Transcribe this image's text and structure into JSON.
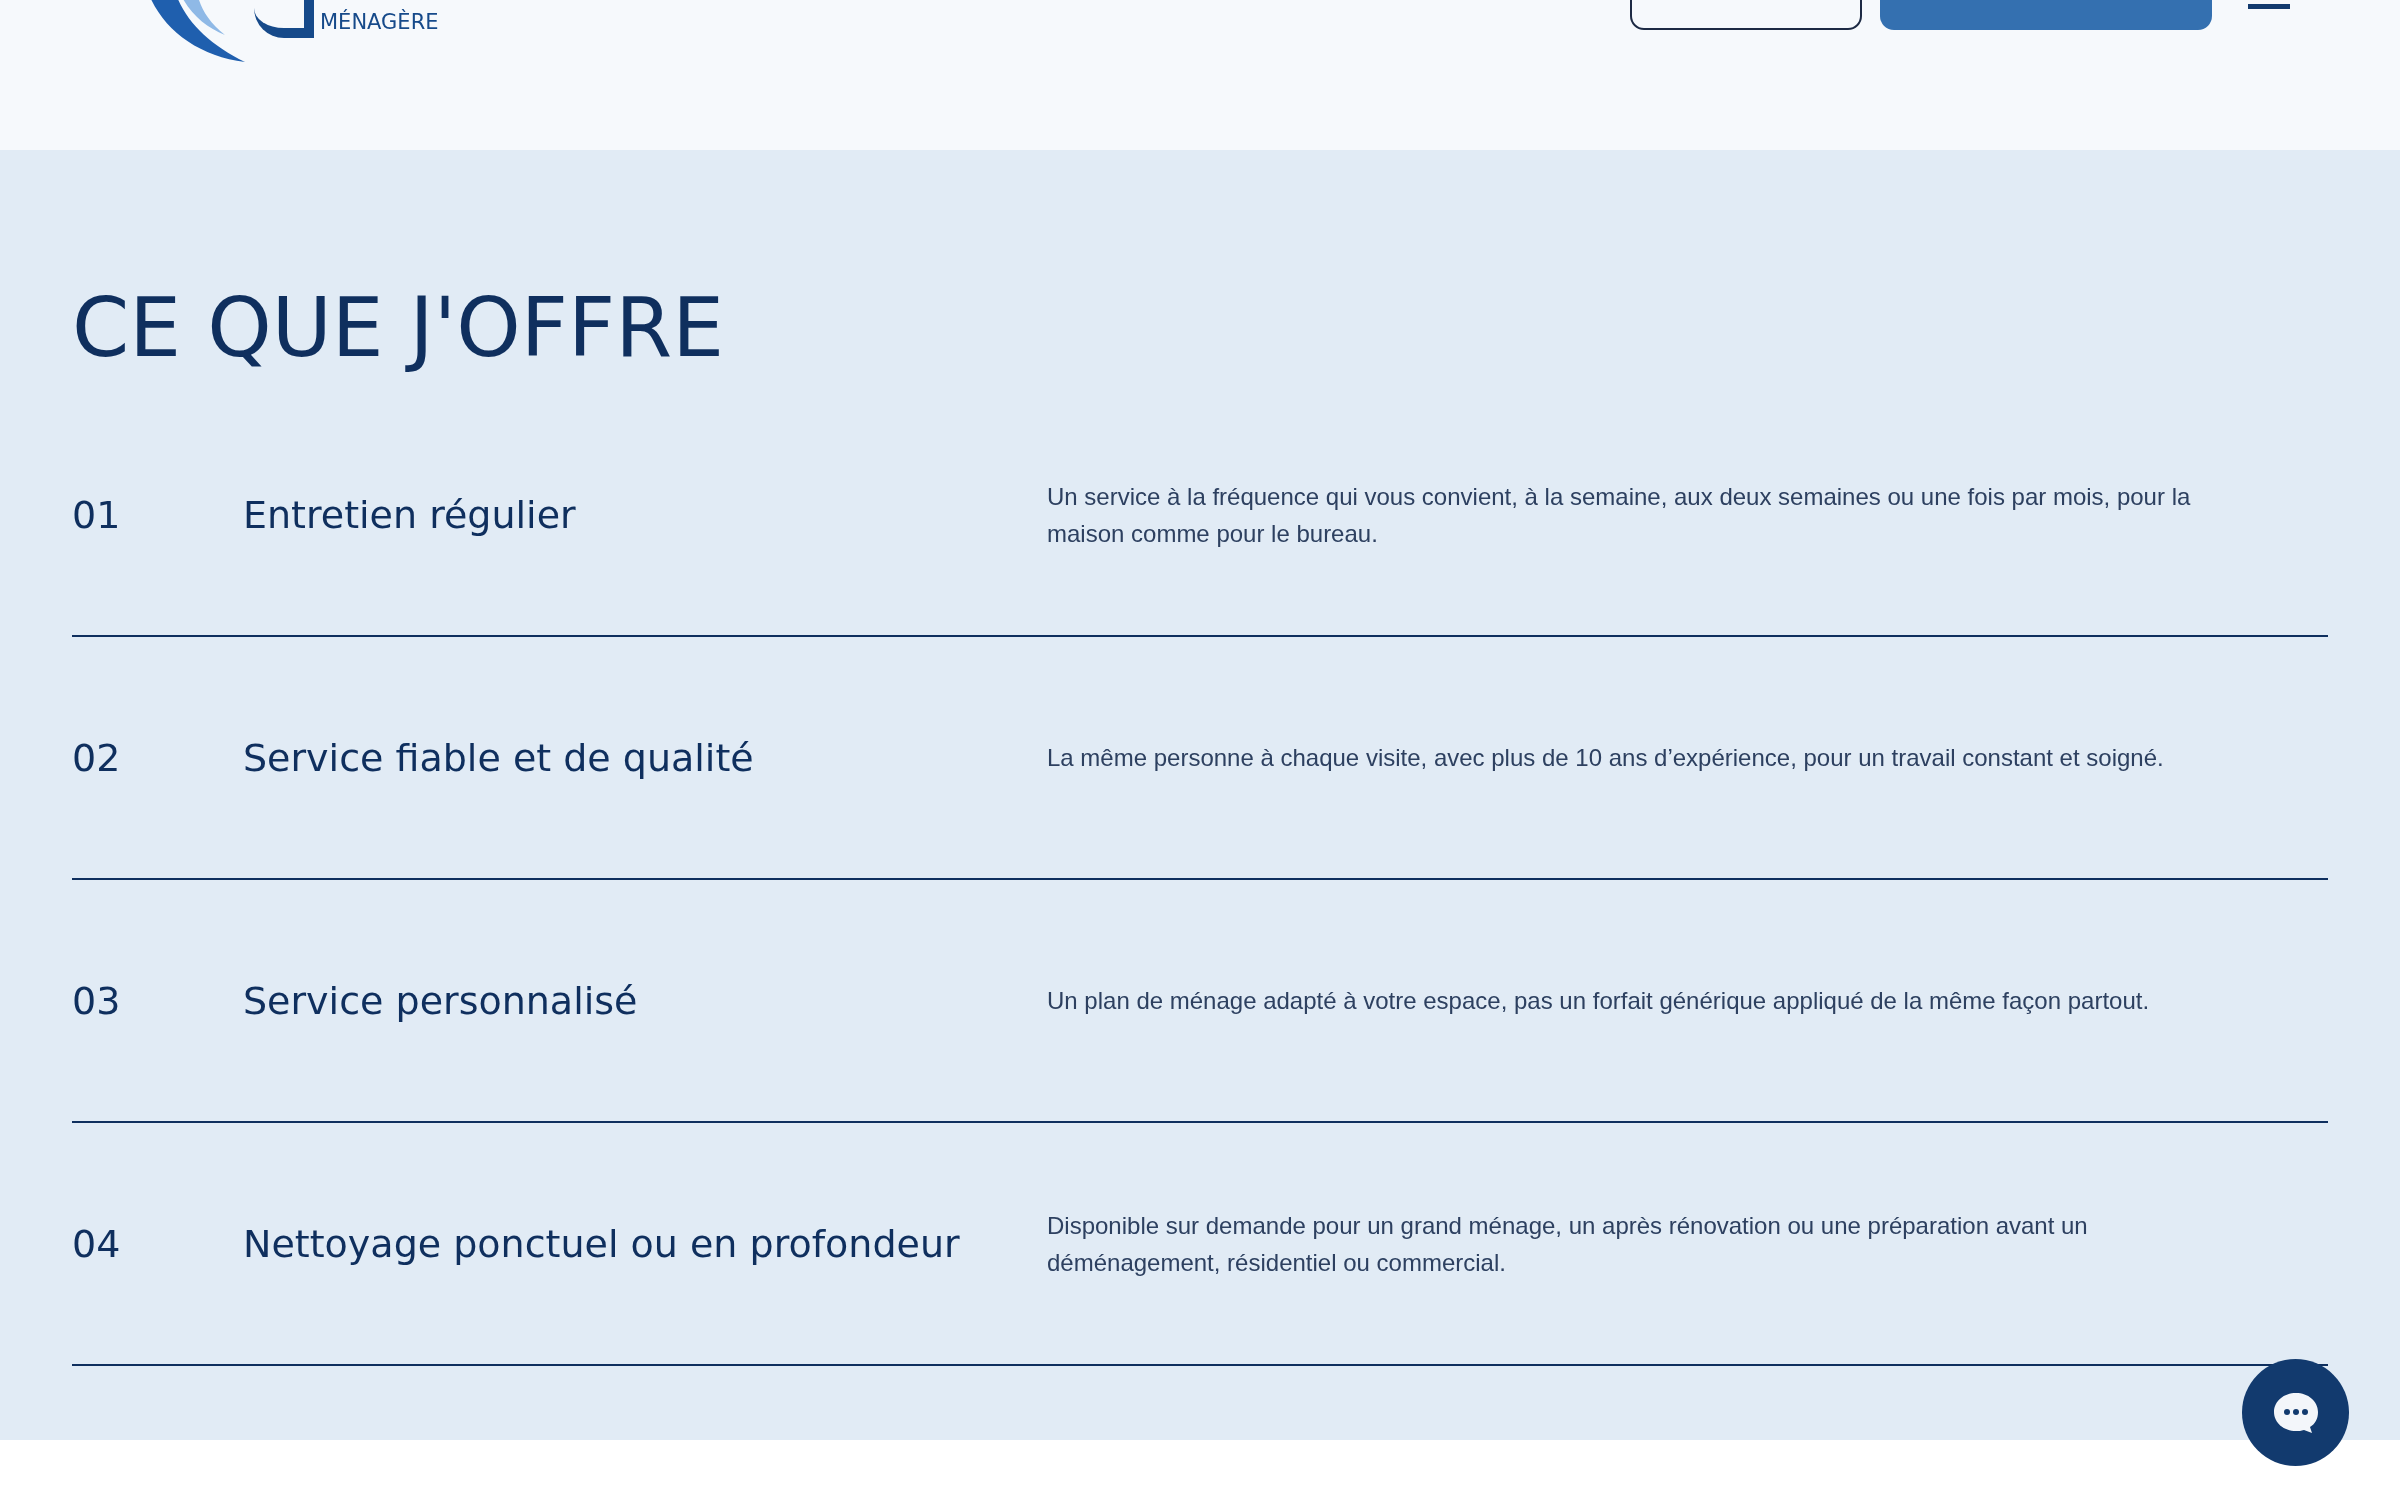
{
  "header": {
    "logo": {
      "subtitle": "MÉNAGÈRE"
    }
  },
  "services": {
    "title": "CE QUE J'OFFRE",
    "items": [
      {
        "number": "01",
        "title": "Entretien régulier",
        "description": "Un service à la fréquence qui vous convient, à la semaine, aux deux semaines ou une fois par mois, pour la maison comme pour le bureau."
      },
      {
        "number": "02",
        "title": "Service fiable et de qualité",
        "description": "La même personne à chaque visite, avec plus de 10 ans d’expérience, pour un travail constant et soigné."
      },
      {
        "number": "03",
        "title": "Service personnalisé",
        "description": "Un plan de ménage adapté à votre espace, pas un forfait générique appliqué de la même façon partout."
      },
      {
        "number": "04",
        "title": "Nettoyage ponctuel ou en profondeur",
        "description": "Disponible sur demande pour un grand ménage, un après rénovation ou une préparation avant un déménagement, résidentiel ou commercial."
      }
    ]
  }
}
